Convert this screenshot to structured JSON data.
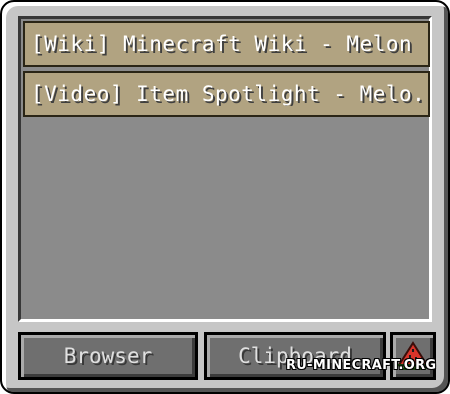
{
  "links": [
    {
      "label": "[Wiki] Minecraft Wiki - Melon"
    },
    {
      "label": "[Video] Item Spotlight - Melo..."
    }
  ],
  "buttons": {
    "browser_label": "Browser",
    "clipboard_label": "Clipboard"
  },
  "icon_button": {
    "icon": "melon-slice-icon"
  },
  "watermark": "RU-MINECRAFT.ORG",
  "colors": {
    "panel": "#c6c6c6",
    "list_background": "#8b8b8b",
    "list_item": "#b1a381",
    "button": "#6f6f6f",
    "melon_red": "#d8342a",
    "melon_green": "#3f9b2a"
  }
}
